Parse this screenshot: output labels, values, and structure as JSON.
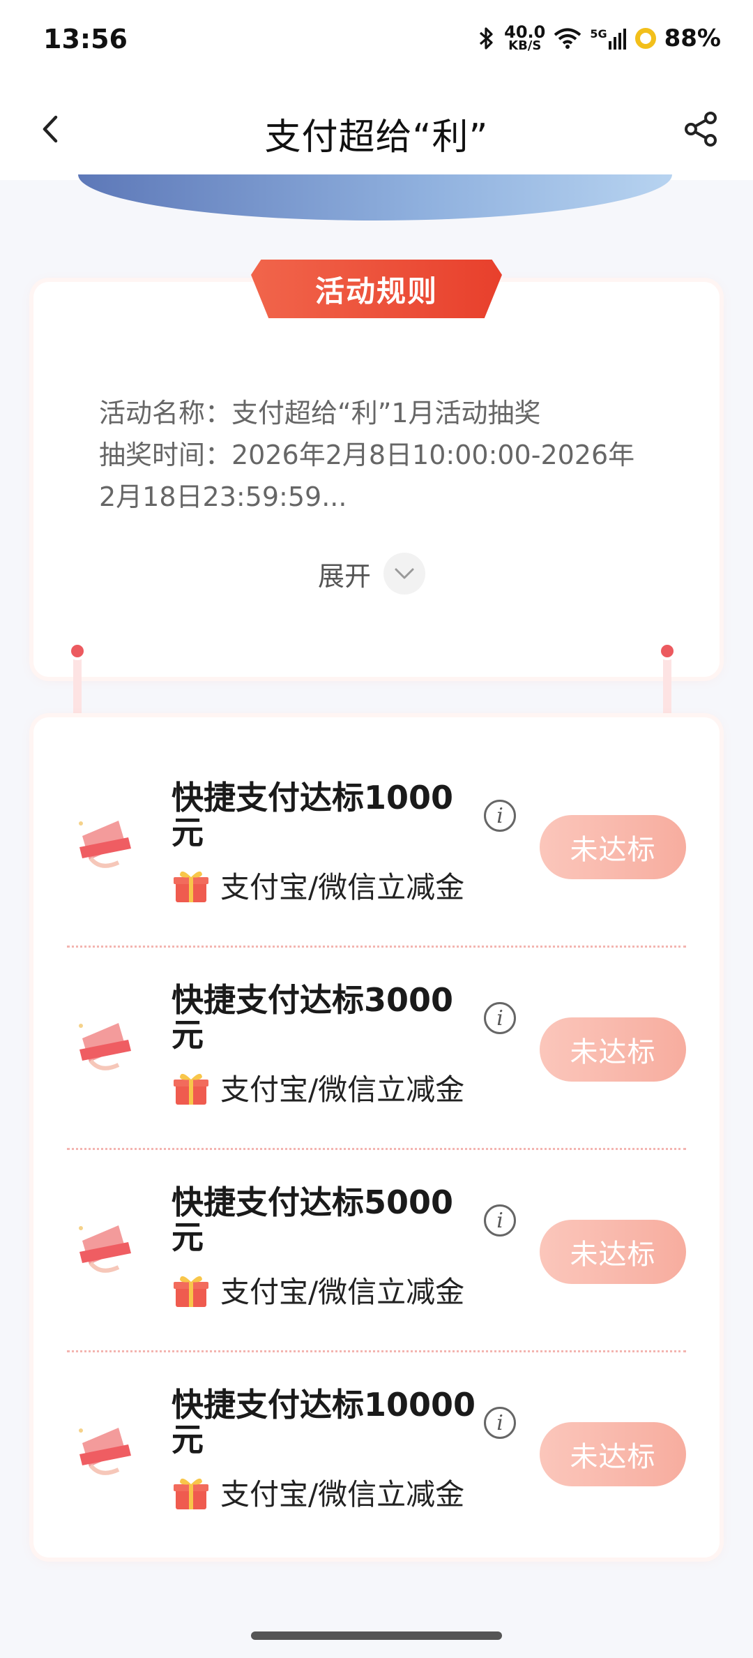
{
  "status_bar": {
    "time": "13:56",
    "net_speed_value": "40.0",
    "net_speed_unit": "KB/S",
    "signal": "5G",
    "battery": "88%"
  },
  "nav": {
    "title": "支付超给“利”"
  },
  "rules": {
    "tab_label": "活动规则",
    "line1": "活动名称：支付超给“利”1月活动抽奖",
    "line2": "抽奖时间：2026年2月8日10:00:00-2026年",
    "line3": "2月18日23:59:59...",
    "expand_label": "展开"
  },
  "tasks": [
    {
      "title_line1": "快捷支付达标1000",
      "title_line2": "元",
      "reward": "支付宝/微信立减金",
      "status": "未达标"
    },
    {
      "title_line1": "快捷支付达标3000",
      "title_line2": "元",
      "reward": "支付宝/微信立减金",
      "status": "未达标"
    },
    {
      "title_line1": "快捷支付达标5000",
      "title_line2": "元",
      "reward": "支付宝/微信立减金",
      "status": "未达标"
    },
    {
      "title_line1": "快捷支付达标10000",
      "title_line2": "元",
      "reward": "支付宝/微信立减金",
      "status": "未达标"
    }
  ],
  "colors": {
    "accent": "#e8402c",
    "status_button": "#f7ad9f",
    "banner": "#91b2df"
  }
}
